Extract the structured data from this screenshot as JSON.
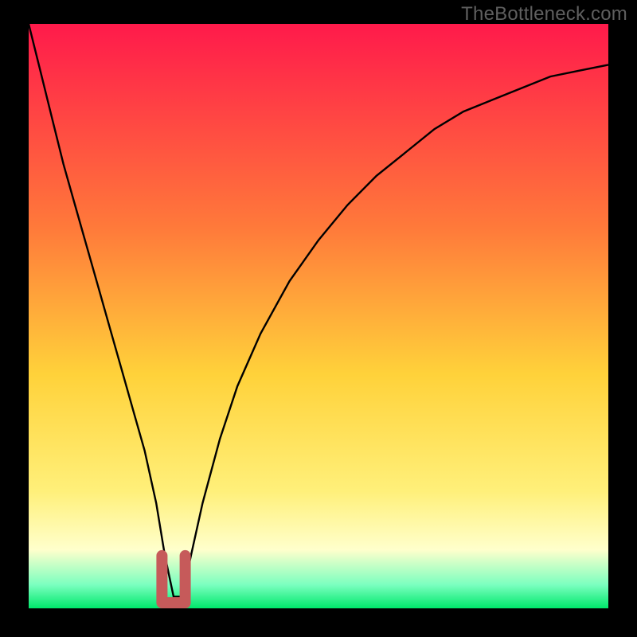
{
  "watermark": {
    "text": "TheBottleneck.com"
  },
  "colors": {
    "bg": "#000000",
    "grad_top": "#ff1a4b",
    "grad_mid1": "#ff7a3a",
    "grad_mid2": "#ffd23a",
    "grad_yellow": "#fff07a",
    "grad_pale": "#ffffcc",
    "grad_mint": "#7affbf",
    "grad_green": "#00e86b",
    "curve": "#000000",
    "marker": "#c65a5a"
  },
  "chart_data": {
    "type": "line",
    "title": "",
    "xlabel": "",
    "ylabel": "",
    "xlim": [
      0,
      100
    ],
    "ylim": [
      0,
      100
    ],
    "series": [
      {
        "name": "bottleneck-curve",
        "x": [
          0,
          2,
          4,
          6,
          8,
          10,
          12,
          14,
          16,
          18,
          20,
          22,
          23.5,
          25,
          26.5,
          28,
          30,
          33,
          36,
          40,
          45,
          50,
          55,
          60,
          65,
          70,
          75,
          80,
          85,
          90,
          95,
          100
        ],
        "values": [
          100,
          92,
          84,
          76,
          69,
          62,
          55,
          48,
          41,
          34,
          27,
          18,
          9,
          2,
          2,
          9,
          18,
          29,
          38,
          47,
          56,
          63,
          69,
          74,
          78,
          82,
          85,
          87,
          89,
          91,
          92,
          93
        ]
      }
    ],
    "marker": {
      "name": "optimal-range",
      "shape": "U",
      "x_range": [
        23,
        27
      ],
      "y_range": [
        0,
        9
      ]
    }
  }
}
